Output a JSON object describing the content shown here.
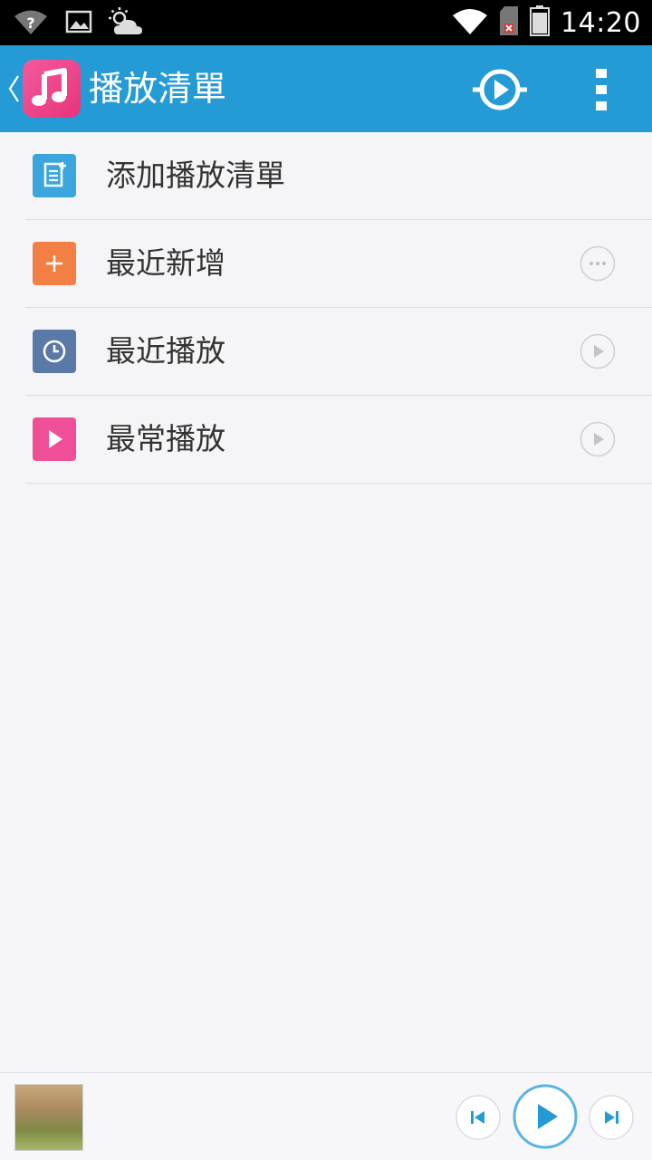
{
  "status_bar": {
    "time": "14:20",
    "icons": [
      "wifi-question-icon",
      "image-icon",
      "weather-cloud-sun-icon",
      "wifi-icon",
      "sim-no-card-icon",
      "battery-icon"
    ]
  },
  "app_bar": {
    "title": "播放清單",
    "icons": [
      "back-chevron-icon",
      "music-note-icon",
      "play-mode-icon",
      "overflow-menu-icon"
    ],
    "accent_color": "#259bd6"
  },
  "list": {
    "items": [
      {
        "label": "添加播放清單",
        "icon": "add-playlist-icon",
        "icon_color": "#3aa6dd",
        "action": null
      },
      {
        "label": "最近新增",
        "icon": "plus-icon",
        "icon_color": "#f47f45",
        "action": "more-icon"
      },
      {
        "label": "最近播放",
        "icon": "clock-icon",
        "icon_color": "#5b79a8",
        "action": "play-icon"
      },
      {
        "label": "最常播放",
        "icon": "play-triangle-icon",
        "icon_color": "#ee4f96",
        "action": "play-icon"
      }
    ]
  },
  "player": {
    "controls": [
      "previous-icon",
      "play-icon",
      "next-icon"
    ],
    "control_color": "#259bd6"
  }
}
